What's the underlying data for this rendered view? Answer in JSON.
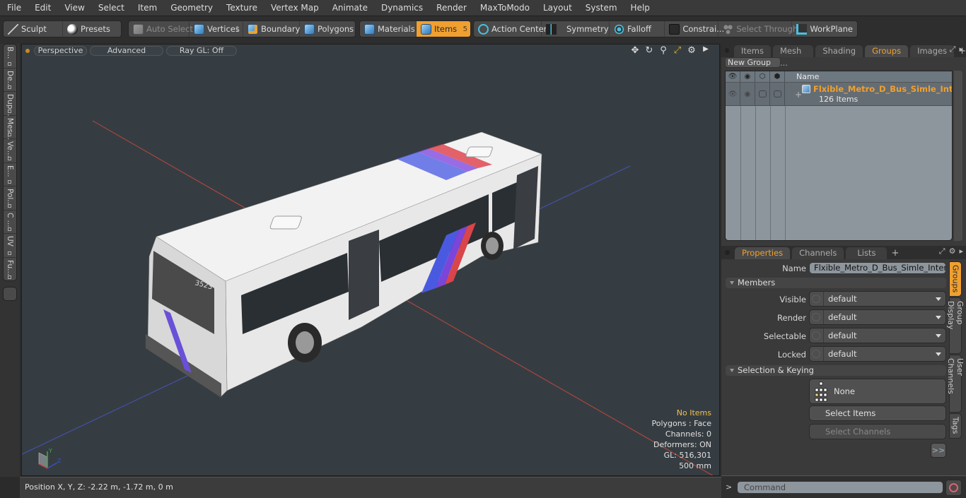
{
  "menubar": [
    "File",
    "Edit",
    "View",
    "Select",
    "Item",
    "Geometry",
    "Texture",
    "Vertex Map",
    "Animate",
    "Dynamics",
    "Render",
    "MaxToModo",
    "Layout",
    "System",
    "Help"
  ],
  "toolbar": {
    "sculpt": "Sculpt",
    "presets": "Presets",
    "auto_select": "Auto Select",
    "vertices": "Vertices",
    "vertices_count": "1",
    "boundary": "Boundary",
    "polygons": "Polygons",
    "materials": "Materials",
    "items": "Items",
    "items_count": "5",
    "action_center": "Action Center",
    "symmetry": "Symmetry",
    "falloff": "Falloff",
    "constraints": "Constrai...",
    "select_through": "Select Through",
    "workplane": "WorkPlane"
  },
  "left_tabs": [
    "B...",
    "De...",
    "Dup...",
    "Mes...",
    "Ve...",
    "E...",
    "Pol...",
    "C ...",
    "UV",
    "Fu..."
  ],
  "viewport": {
    "view_mode": "Perspective",
    "shading": "Advanced",
    "raygl": "Ray GL: Off",
    "info": {
      "selection": "No Items",
      "polygons": "Polygons : Face",
      "channels": "Channels: 0",
      "deformers": "Deformers: ON",
      "gl": "GL: 516,301",
      "scale": "500 mm"
    },
    "bus_number": "3523",
    "colors": {
      "background": "#363d42",
      "axis_x": "#c0473f",
      "axis_z": "#4553b8",
      "stripe_red": "#d8454a",
      "stripe_purple": "#7a45d8",
      "stripe_blue": "#4a5ae0"
    }
  },
  "statusbar": {
    "position": "Position X, Y, Z:   -2.22 m, -1.72 m, 0 m"
  },
  "groups_panel": {
    "tabs": [
      "Items",
      "Mesh ...",
      "Shading",
      "Groups",
      "Images"
    ],
    "active_tab": "Groups",
    "new_group": "New Group",
    "column_name": "Name",
    "rows": [
      {
        "name": "Flxible_Metro_D_Bus_Simle_Int...",
        "count": "126 Items"
      }
    ]
  },
  "properties_panel": {
    "tabs": [
      "Properties",
      "Channels",
      "Lists"
    ],
    "active_tab": "Properties",
    "name_label": "Name",
    "name_value": "Flxible_Metro_D_Bus_Simle_Interior (:",
    "members_section": "Members",
    "fields": [
      {
        "label": "Visible",
        "value": "default"
      },
      {
        "label": "Render",
        "value": "default"
      },
      {
        "label": "Selectable",
        "value": "default"
      },
      {
        "label": "Locked",
        "value": "default"
      }
    ],
    "selection_section": "Selection & Keying",
    "keying_value": "None",
    "select_items": "Select Items",
    "select_channels": "Select Channels",
    "more": ">>",
    "side_tabs": [
      "Groups",
      "Group Display",
      "User Channels",
      "Tags"
    ],
    "accent": "#f0a030"
  },
  "command": {
    "prompt": ">",
    "placeholder": "Command"
  }
}
